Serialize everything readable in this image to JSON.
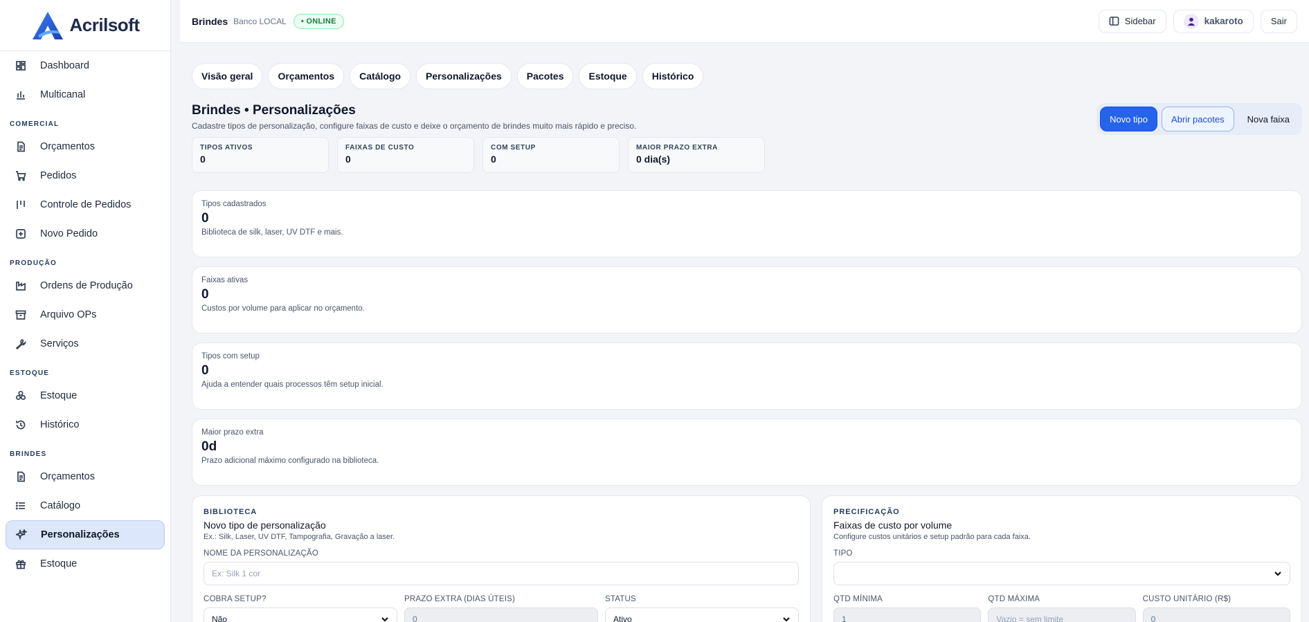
{
  "brand": {
    "name": "Acrilsoft",
    "accent": "#2563eb"
  },
  "sidebar": {
    "top_items": [
      {
        "label": "Dashboard",
        "icon": "dashboard-icon"
      },
      {
        "label": "Multicanal",
        "icon": "bar-chart-icon"
      }
    ],
    "sections": [
      {
        "title": "COMERCIAL",
        "items": [
          {
            "label": "Orçamentos",
            "icon": "document-icon"
          },
          {
            "label": "Pedidos",
            "icon": "cart-icon"
          },
          {
            "label": "Controle de Pedidos",
            "icon": "columns-icon"
          },
          {
            "label": "Novo Pedido",
            "icon": "plus-square-icon"
          }
        ]
      },
      {
        "title": "PRODUÇÃO",
        "items": [
          {
            "label": "Ordens de Produção",
            "icon": "factory-icon"
          },
          {
            "label": "Arquivo OPs",
            "icon": "archive-icon"
          },
          {
            "label": "Serviços",
            "icon": "wrench-icon"
          }
        ]
      },
      {
        "title": "ESTOQUE",
        "items": [
          {
            "label": "Estoque",
            "icon": "boxes-icon"
          },
          {
            "label": "Histórico",
            "icon": "history-icon"
          }
        ]
      },
      {
        "title": "BRINDES",
        "items": [
          {
            "label": "Orçamentos",
            "icon": "document-icon"
          },
          {
            "label": "Catálogo",
            "icon": "list-icon"
          },
          {
            "label": "Personalizações",
            "icon": "sparkles-icon",
            "active": true
          },
          {
            "label": "Estoque",
            "icon": "gift-icon"
          }
        ]
      }
    ]
  },
  "topbar": {
    "module": "Brindes",
    "database": "Banco LOCAL",
    "status": "• ONLINE",
    "sidebar_button": "Sidebar",
    "user": "kakaroto",
    "logout": "Sair"
  },
  "tabs": [
    "Visão geral",
    "Orçamentos",
    "Catálogo",
    "Personalizações",
    "Pacotes",
    "Estoque",
    "Histórico"
  ],
  "page": {
    "title": "Brindes • Personalizações",
    "description": "Cadastre tipos de personalização, configure faixas de custo e deixe o orçamento de brindes muito mais rápido e preciso.",
    "actions": {
      "primary": "Novo tipo",
      "secondary": "Abrir pacotes",
      "tertiary": "Nova faixa"
    }
  },
  "stats": [
    {
      "label": "TIPOS ATIVOS",
      "value": "0"
    },
    {
      "label": "FAIXAS DE CUSTO",
      "value": "0"
    },
    {
      "label": "COM SETUP",
      "value": "0"
    },
    {
      "label": "MAIOR PRAZO EXTRA",
      "value": "0 dia(s)"
    }
  ],
  "cards": [
    {
      "label": "Tipos cadastrados",
      "value": "0",
      "desc": "Biblioteca de silk, laser, UV DTF e mais."
    },
    {
      "label": "Faixas ativas",
      "value": "0",
      "desc": "Custos por volume para aplicar no orçamento."
    },
    {
      "label": "Tipos com setup",
      "value": "0",
      "desc": "Ajuda a entender quais processos têm setup inicial."
    },
    {
      "label": "Maior prazo extra",
      "value": "0d",
      "desc": "Prazo adicional máximo configurado na biblioteca."
    }
  ],
  "library": {
    "kicker": "BIBLIOTECA",
    "title": "Novo tipo de personalização",
    "desc": "Ex.: Silk, Laser, UV DTF, Tampografia, Gravação a laser.",
    "name_label": "NOME DA PERSONALIZAÇÃO",
    "name_placeholder": "Ex: Silk 1 cor",
    "setup_label": "COBRA SETUP?",
    "setup_value": "Não",
    "prazo_label": "PRAZO EXTRA (DIAS ÚTEIS)",
    "prazo_value": "0",
    "status_label": "STATUS",
    "status_value": "Ativo"
  },
  "pricing": {
    "kicker": "PRECIFICAÇÃO",
    "title": "Faixas de custo por volume",
    "desc": "Configure custos unitários e setup padrão para cada faixa.",
    "tipo_label": "TIPO",
    "tipo_value": "",
    "qmin_label": "QTD MÍNIMA",
    "qmin_value": "1",
    "qmax_label": "QTD MÁXIMA",
    "qmax_placeholder": "Vazio = sem limite",
    "custo_label": "CUSTO UNITÁRIO (R$)",
    "custo_value": "0"
  }
}
